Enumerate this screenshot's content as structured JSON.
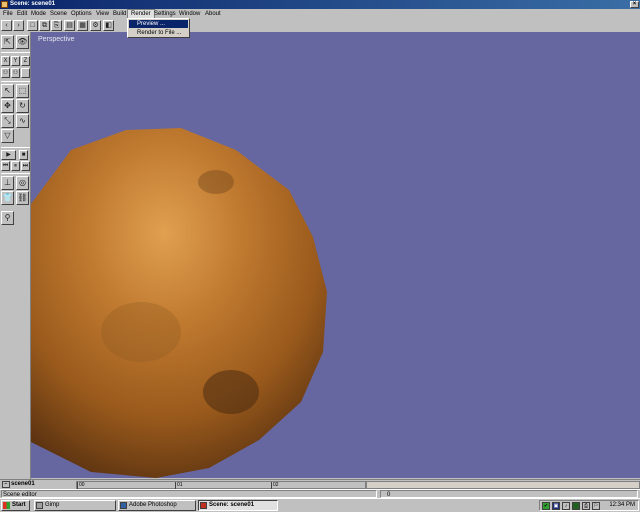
{
  "window": {
    "title": "Scene: scene01",
    "close_glyph": "×"
  },
  "menu": {
    "items": [
      "File",
      "Edit",
      "Mode",
      "Scene",
      "Options",
      "View",
      "Build",
      "Render",
      "Settings",
      "Window",
      "About"
    ],
    "open_menu": "Render",
    "dropdown": [
      "Preview ...",
      "Render to File ..."
    ]
  },
  "toolbar": {
    "icons": [
      "back-icon",
      "forward-icon",
      "new-icon",
      "copy-icon",
      "paste-icon",
      "document-icon",
      "grid-icon",
      "settings-icon",
      "color-icon"
    ],
    "glyphs": [
      "‹",
      "›",
      "□",
      "⧉",
      "⎘",
      "▤",
      "▦",
      "⚙",
      "◧"
    ]
  },
  "left_tools": {
    "axis_labels": [
      "X",
      "Y",
      "Z"
    ],
    "glyphs": {
      "arrow": "⇱",
      "eye": "👁",
      "select": "↖",
      "marquee": "⬚",
      "move": "✥",
      "rotate": "↻",
      "scale": "⤡",
      "curve": "∿",
      "cone": "▽",
      "play": "▶",
      "stop": "■",
      "rewind": "⏮",
      "pause": "⏸",
      "forward": "⏭",
      "bones": "⊥",
      "sphere": "◎",
      "shirt": "👕",
      "link": "⛓",
      "key": "⚲",
      "rig": "⚇"
    }
  },
  "viewport": {
    "label": "Perspective",
    "background": "#6666a0"
  },
  "timeline": {
    "scene_name": "scene01",
    "toggle_glyph": "−",
    "ticks": [
      "00",
      "01",
      "02"
    ]
  },
  "status": {
    "left": "Scene editor",
    "right": "0"
  },
  "taskbar": {
    "start_label": "Start",
    "tasks": [
      {
        "label": "Gimp",
        "pressed": false
      },
      {
        "label": "Adobe Photoshop",
        "pressed": false
      },
      {
        "label": "Scene: scene01",
        "pressed": true
      }
    ],
    "tray_icons": [
      "network-icon",
      "display-icon",
      "volume-icon",
      "monitor-icon",
      "printer-icon",
      "security-icon"
    ],
    "tray_glyphs": [
      "✔",
      "▣",
      "♪",
      "■",
      "⎙",
      "⚐"
    ],
    "clock": "12:34 PM"
  }
}
